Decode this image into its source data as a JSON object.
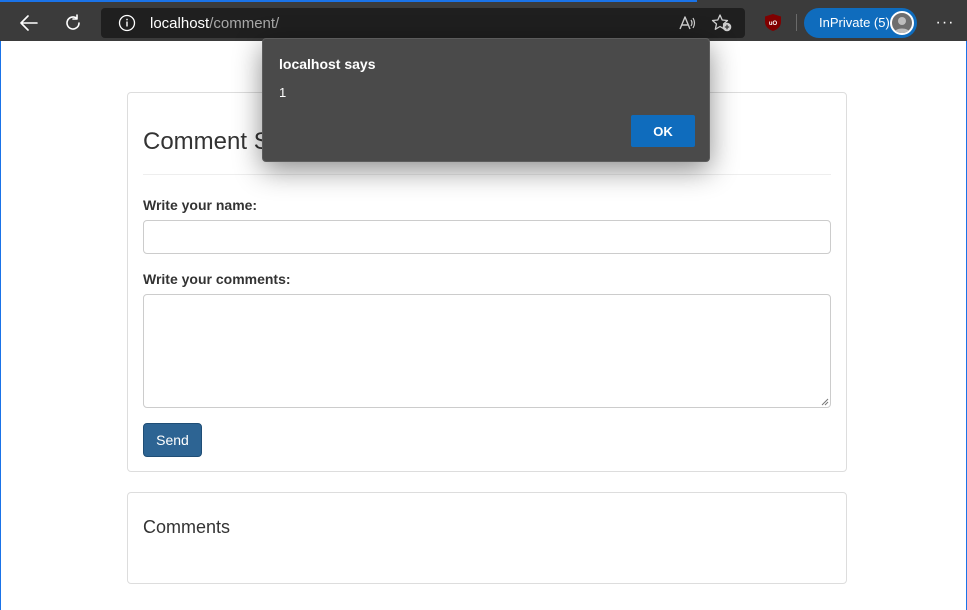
{
  "browser": {
    "address": {
      "host": "localhost",
      "path": "/comment/"
    },
    "inprivate_label": "InPrivate (5)",
    "more_label": "···",
    "icons": [
      "back-arrow-icon",
      "refresh-icon",
      "info-icon",
      "read-aloud-icon",
      "favorite-add-icon",
      "ublock-origin-icon",
      "profile-avatar-icon"
    ],
    "accent_color": "#0f6cbd"
  },
  "form": {
    "title": "Comment S",
    "name_label": "Write your name:",
    "name_value": "",
    "comments_label": "Write your comments:",
    "comments_value": "",
    "send_label": "Send",
    "send_color": "#2d6493"
  },
  "comments_section": {
    "title": "Comments"
  },
  "alert": {
    "title": "localhost says",
    "message": "1",
    "ok_label": "OK"
  }
}
